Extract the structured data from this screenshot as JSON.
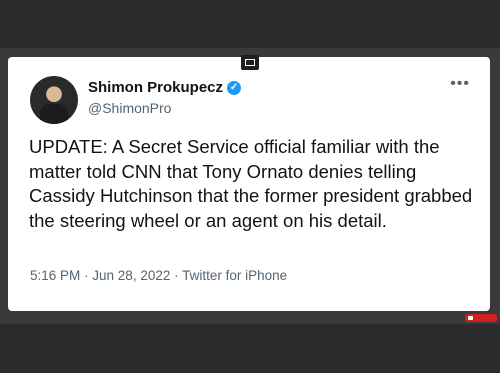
{
  "tweet": {
    "author_name": "Shimon Prokupecz",
    "author_handle": "@ShimonPro",
    "more_icon": "•••",
    "verified_icon": "✓",
    "text": "UPDATE: A Secret Service official familiar with the matter told CNN that Tony Ornato denies telling Cassidy Hutchinson that the former president grabbed the steering wheel or an agent on his detail.",
    "time": "5:16 PM",
    "date": "Jun 28, 2022",
    "source": "Twitter for iPhone",
    "separator": " · "
  },
  "colors": {
    "verified_blue": "#1d9bf0",
    "text_primary": "#0f1419",
    "text_secondary": "#536471",
    "background": "#2b2b2b"
  },
  "icons": {
    "verified": "verified-badge-icon",
    "more": "more-options-icon",
    "media": "media-window-icon",
    "youtube": "youtube-subscribe-icon"
  }
}
